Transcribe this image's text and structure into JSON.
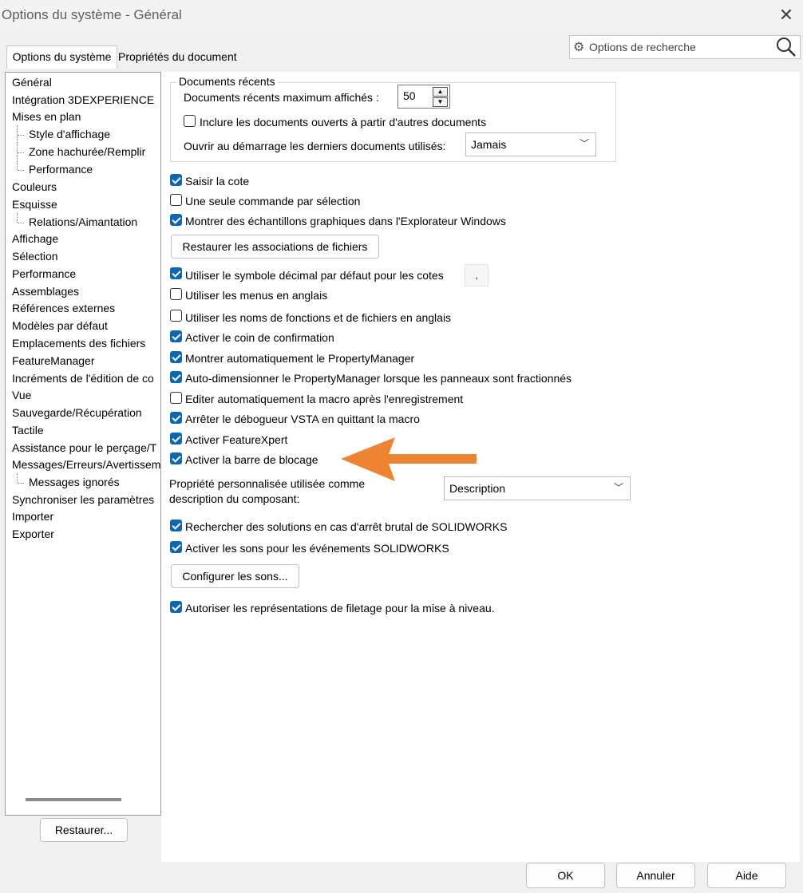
{
  "window": {
    "title": "Options du système - Général"
  },
  "tabs": [
    {
      "label": "Options du système"
    },
    {
      "label": "Propriétés du document"
    }
  ],
  "search": {
    "placeholder": "Options de recherche"
  },
  "tree": [
    {
      "label": "Général"
    },
    {
      "label": "Intégration 3DEXPERIENCE"
    },
    {
      "label": "Mises en plan"
    },
    {
      "label": "Style d'affichage"
    },
    {
      "label": "Zone hachurée/Remplir"
    },
    {
      "label": "Performance"
    },
    {
      "label": "Couleurs"
    },
    {
      "label": "Esquisse"
    },
    {
      "label": "Relations/Aimantation"
    },
    {
      "label": "Affichage"
    },
    {
      "label": "Sélection"
    },
    {
      "label": "Performance"
    },
    {
      "label": "Assemblages"
    },
    {
      "label": "Références externes"
    },
    {
      "label": "Modèles par défaut"
    },
    {
      "label": "Emplacements des fichiers"
    },
    {
      "label": "FeatureManager"
    },
    {
      "label": "Incréments de l'édition de co"
    },
    {
      "label": "Vue"
    },
    {
      "label": "Sauvegarde/Récupération"
    },
    {
      "label": "Tactile"
    },
    {
      "label": "Assistance pour le perçage/T"
    },
    {
      "label": "Messages/Erreurs/Avertissem"
    },
    {
      "label": "Messages ignorés"
    },
    {
      "label": "Synchroniser les paramètres"
    },
    {
      "label": "Importer"
    },
    {
      "label": "Exporter"
    }
  ],
  "restore_button": "Restaurer...",
  "recent_docs": {
    "group_label": "Documents récents",
    "max_label": "Documents récents maximum affichés :",
    "max_value": "50",
    "include_label": "Inclure les documents ouverts à partir d'autres documents",
    "include_checked": false,
    "open_label": "Ouvrir au démarrage les derniers documents utilisés:",
    "open_value": "Jamais"
  },
  "options_a": [
    {
      "label": "Saisir la cote",
      "checked": true
    },
    {
      "label": "Une seule commande par sélection",
      "checked": false
    },
    {
      "label": "Montrer des échantillons graphiques dans l'Explorateur Windows",
      "checked": true
    }
  ],
  "restore_assoc_button": "Restaurer les associations de fichiers",
  "decimal": {
    "label": "Utiliser le symbole décimal par défaut pour les cotes",
    "checked": true,
    "symbol": ","
  },
  "options_b": [
    {
      "label": "Utiliser les menus en anglais",
      "checked": false
    },
    {
      "label": "Utiliser les noms de fonctions et de fichiers en anglais",
      "checked": false
    },
    {
      "label": "Activer le coin de confirmation",
      "checked": true
    },
    {
      "label": "Montrer automatiquement le PropertyManager",
      "checked": true
    },
    {
      "label": "Auto-dimensionner le PropertyManager lorsque les panneaux sont fractionnés",
      "checked": true
    },
    {
      "label": "Editer automatiquement la macro après l'enregistrement",
      "checked": false
    },
    {
      "label": "Arrêter le débogueur VSTA en quittant la macro",
      "checked": true
    },
    {
      "label": "Activer FeatureXpert",
      "checked": true
    },
    {
      "label": "Activer la barre de blocage",
      "checked": true
    }
  ],
  "custom_prop": {
    "label_line1": "Propriété personnalisée utilisée comme",
    "label_line2": "description du composant:",
    "value": "Description"
  },
  "options_c": [
    {
      "label": "Rechercher des solutions en cas d'arrêt brutal de SOLIDWORKS",
      "checked": true
    },
    {
      "label": "Activer les sons pour les événements SOLIDWORKS",
      "checked": true
    }
  ],
  "configure_sounds_button": "Configurer les sons...",
  "thread_option": {
    "label": "Autoriser les représentations de filetage pour la mise à niveau.",
    "checked": true
  },
  "footer": {
    "ok": "OK",
    "cancel": "Annuler",
    "help": "Aide"
  },
  "colors": {
    "accent": "#0f67b4",
    "arrow": "#ee8432"
  }
}
